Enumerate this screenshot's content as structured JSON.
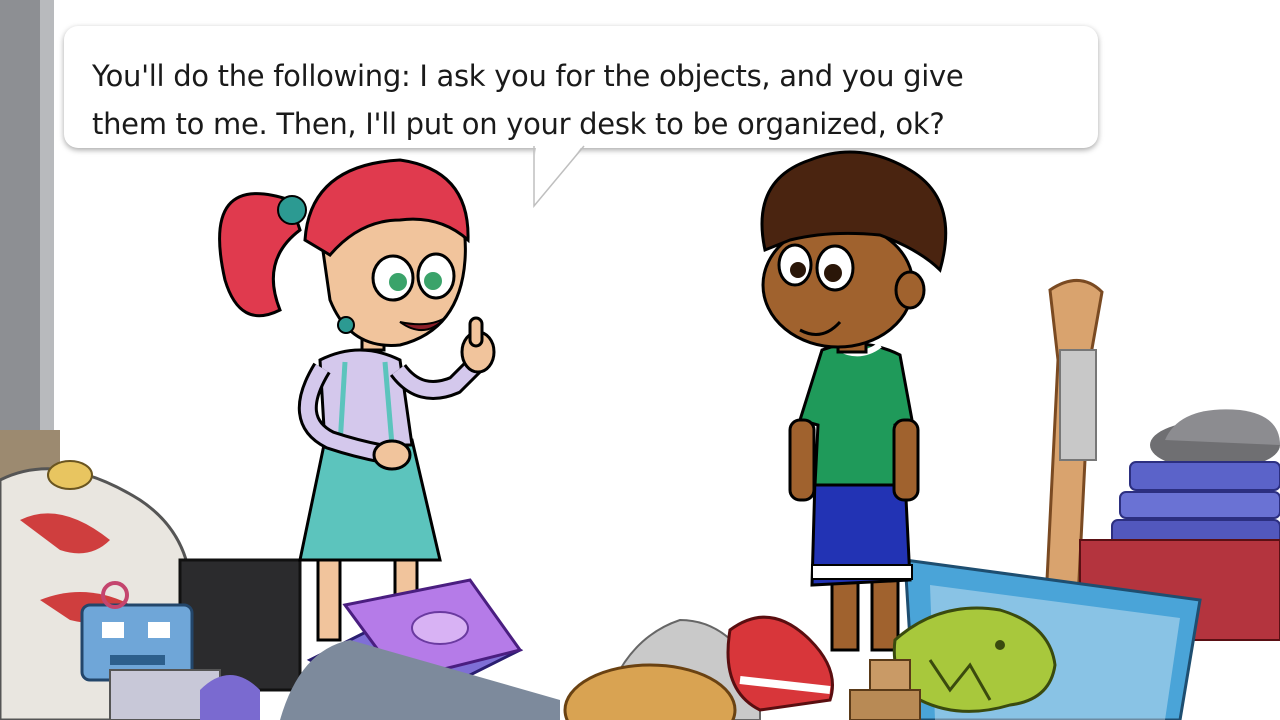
{
  "dialog": {
    "lines": [
      "You'll do the following: I ask you for the objects, and you give",
      "them to me. Then, I'll put on your desk to be organized, ok?"
    ]
  },
  "colors": {
    "wall_left": "#8a8c90",
    "hair_red": "#e03a4e",
    "skirt_teal": "#5cc4bd",
    "shirt_lilac": "#d4c8ec",
    "boy_shirt": "#1f9a5a",
    "boy_shorts": "#2233b4",
    "boy_hair": "#4a2410"
  },
  "characters": [
    "girl-with-red-ponytail",
    "boy-in-green-shirt"
  ],
  "clutter_items": [
    "cds",
    "stuffed-toy",
    "robot-toy",
    "books",
    "baseball-bat",
    "monitor",
    "sneaker",
    "dinosaur-toy",
    "hat"
  ]
}
